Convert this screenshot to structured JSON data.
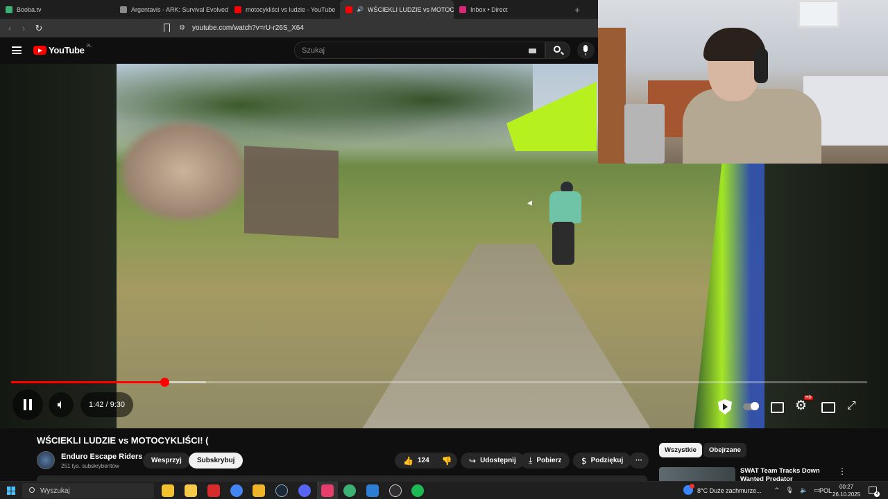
{
  "browser": {
    "tabs": [
      {
        "title": "Booba.tv",
        "favicon_color": "#3bb273"
      },
      {
        "title": "Argentavis - ARK: Survival Evolved W",
        "favicon_color": "#8a8a8a"
      },
      {
        "title": "motocykliści vs ludzie - YouTube",
        "favicon_color": "#ff0000"
      },
      {
        "title": "WŚCIEKLI LUDZIE vs MOTOCY",
        "favicon_color": "#ff0000",
        "active": true
      },
      {
        "title": "Inbox • Direct",
        "favicon_color": "#d62976"
      }
    ],
    "new_tab": "+",
    "close_tab": "×",
    "url": "youtube.com/watch?v=rU-r26S_X64",
    "back": "‹",
    "forward": "›",
    "reload": "↻",
    "tune": "⚙"
  },
  "youtube": {
    "logo": "YouTube",
    "country": "PL",
    "search_placeholder": "Szukaj"
  },
  "player": {
    "current_time": "1:42",
    "duration": "9:30",
    "time_display": "1:42 / 9:30",
    "played_fraction": 0.179,
    "buffered_fraction": 0.228,
    "hd_badge": "HD"
  },
  "video": {
    "title": "WŚCIEKLI LUDZIE vs MOTOCYKLIŚCI! (",
    "channel": "Enduro Escape Riders",
    "subscribers": "251 tys. subskrybentów",
    "support_label": "Wesprzyj",
    "subscribe_label": "Subskrybuj",
    "likes": "124",
    "share_label": "Udostępnij",
    "download_label": "Pobierz",
    "thanks_label": "Podziękuj",
    "more": "···"
  },
  "sidebar": {
    "chips": [
      "Wszystkie",
      "Obejrzane"
    ],
    "recommended": [
      {
        "title": "SWAT Team Tracks Down",
        "title2": "Wanted Predator"
      }
    ]
  },
  "taskbar": {
    "search_placeholder": "Wyszukaj",
    "weather": "8°C  Duże zachmurze...",
    "language": "POL",
    "time": "00:27",
    "date": "26.10.2025",
    "notifications": "4",
    "apps": [
      {
        "name": "notes",
        "color": "#f2c12e"
      },
      {
        "name": "file-explorer",
        "color": "#f7c948"
      },
      {
        "name": "app-red",
        "color": "#d92b2b"
      },
      {
        "name": "chrome",
        "color": "#4285f4"
      },
      {
        "name": "folder",
        "color": "#f0b429"
      },
      {
        "name": "steam",
        "color": "#1b2838"
      },
      {
        "name": "discord",
        "color": "#5865f2"
      },
      {
        "name": "browser-active",
        "color": "#e83e6c"
      },
      {
        "name": "app-green",
        "color": "#3bb273"
      },
      {
        "name": "app-blue",
        "color": "#2d7dd2"
      },
      {
        "name": "obs",
        "color": "#302e31"
      },
      {
        "name": "spotify",
        "color": "#1db954"
      }
    ]
  }
}
